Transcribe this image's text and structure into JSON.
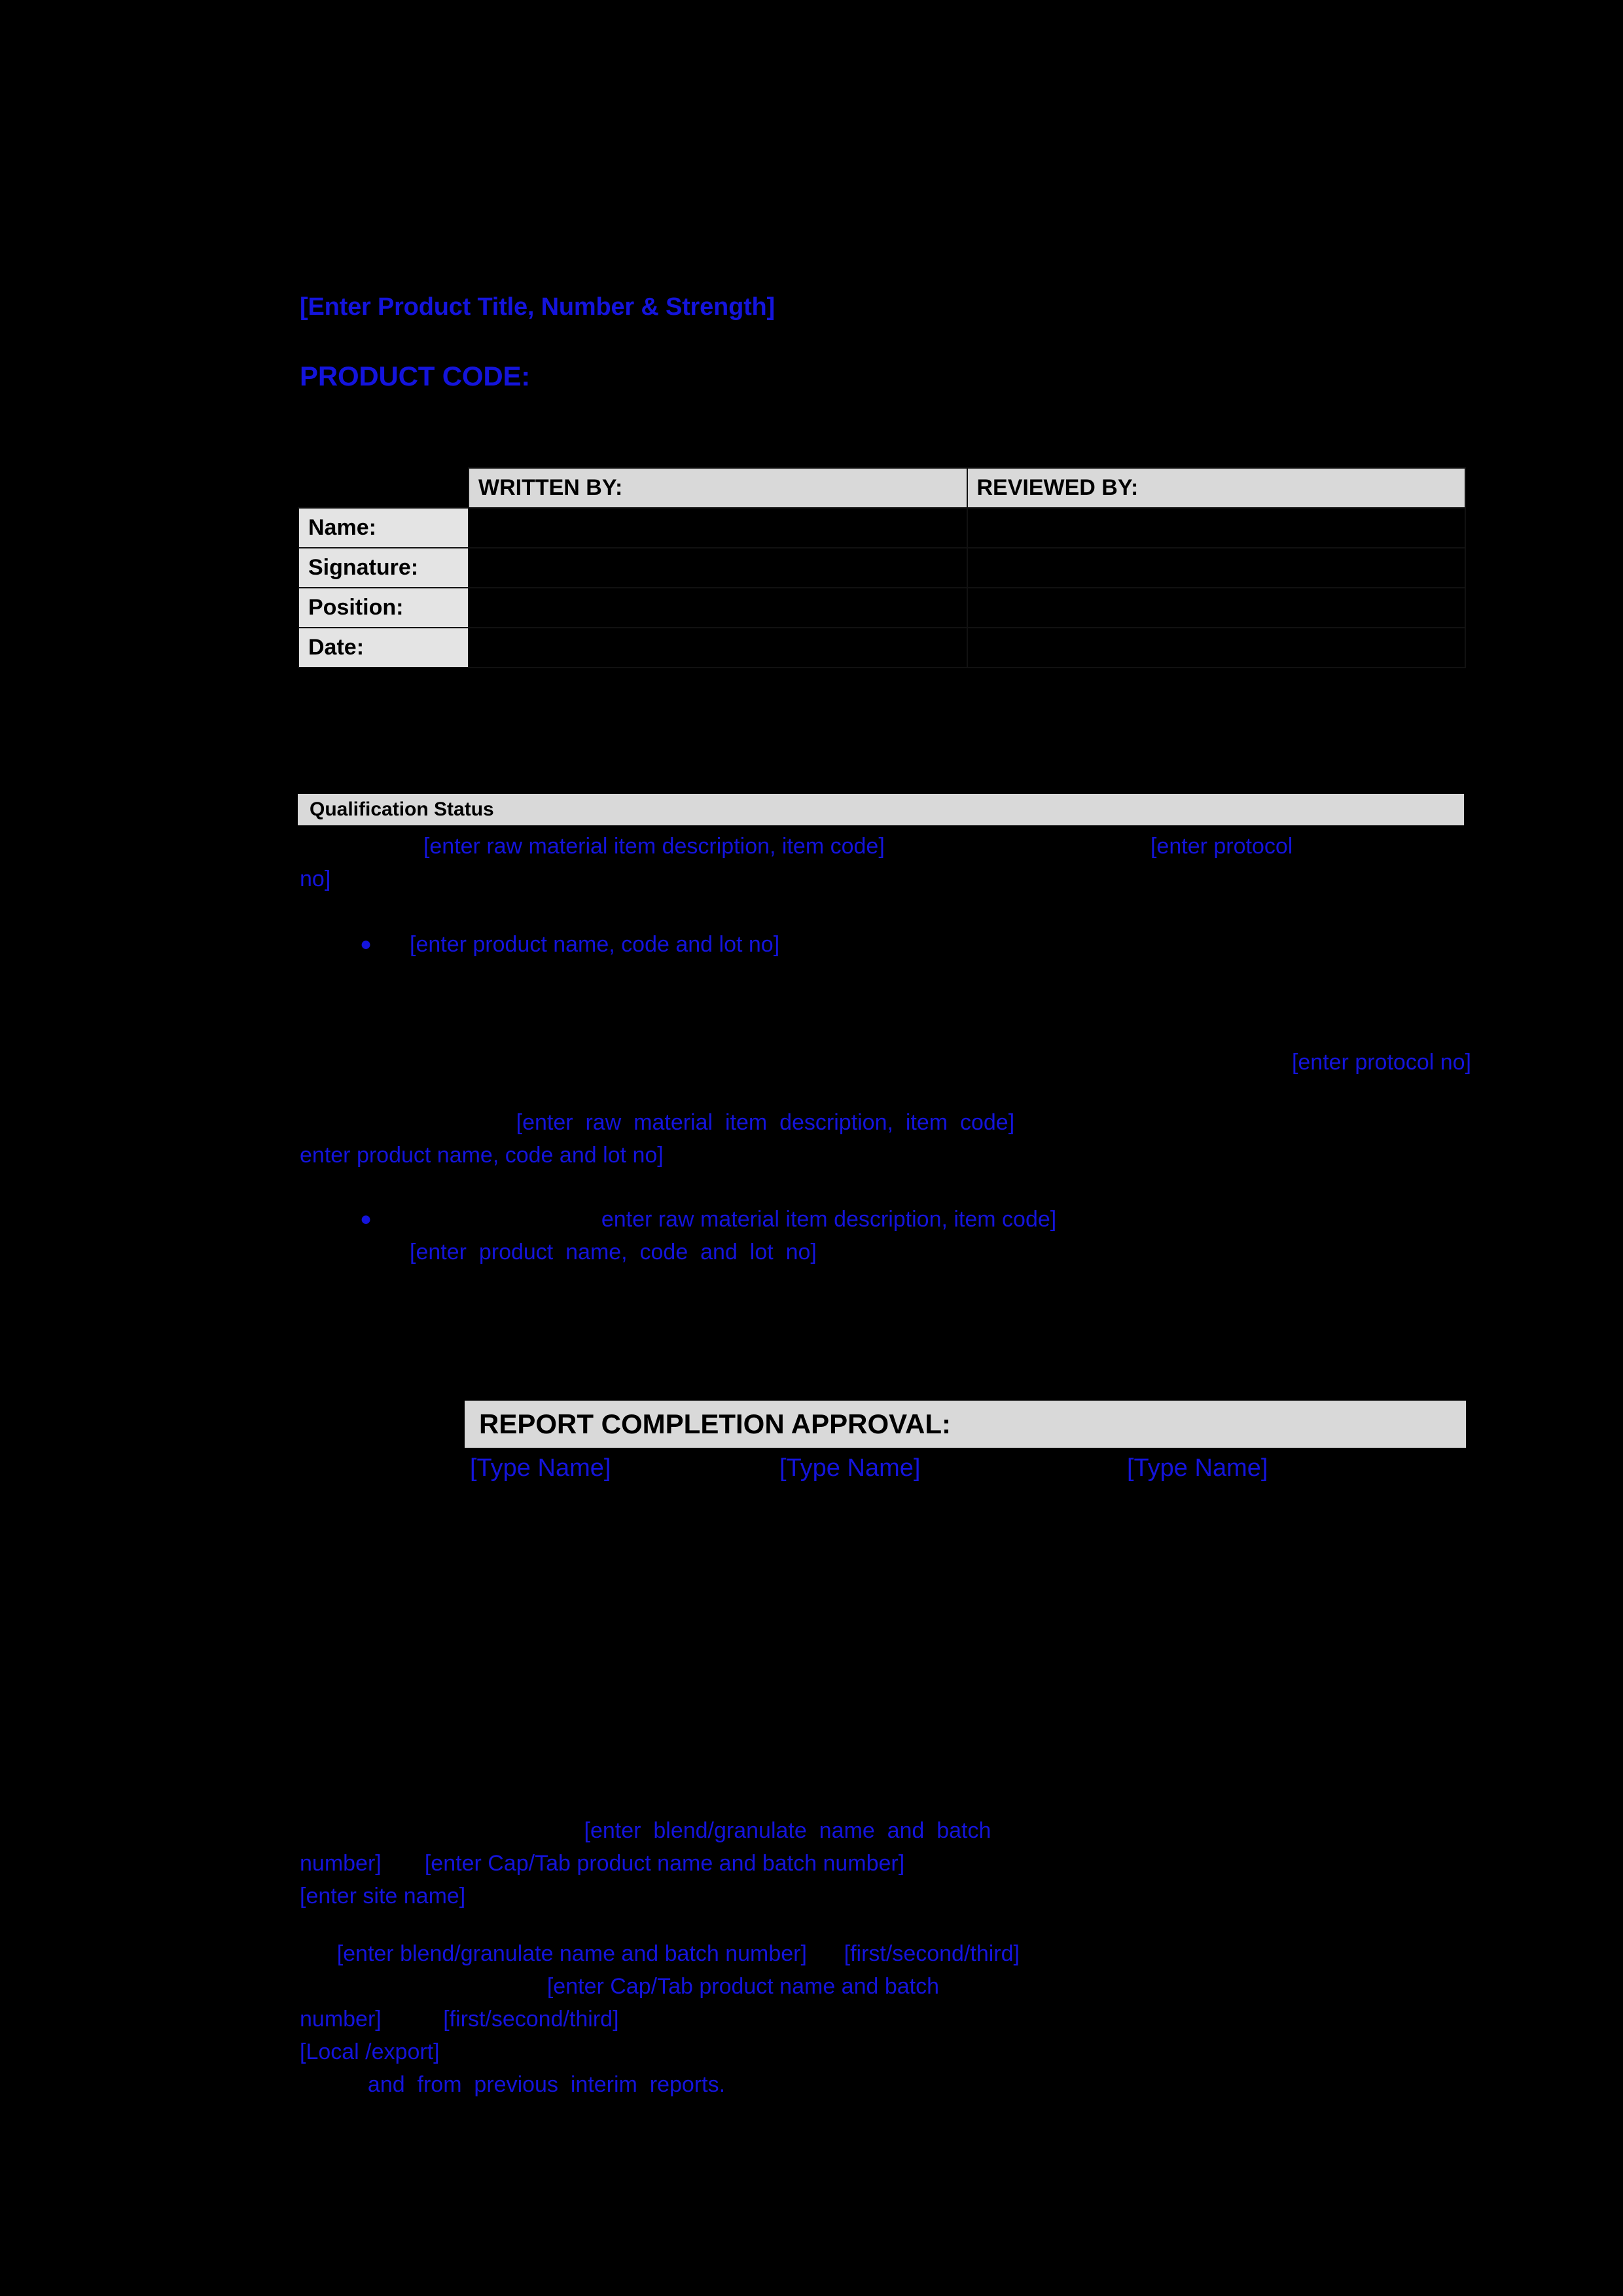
{
  "document": {
    "title": "[Enter Product Title, Number & Strength]",
    "product_code_label": "PRODUCT CODE:"
  },
  "colors": {
    "placeholder_blue": "#1414DC",
    "band_gray": "#D9D9D9",
    "label_gray": "#E4E4E4",
    "page_background": "#000000",
    "border": "#111111"
  },
  "signature_table": {
    "corner": "",
    "columns": [
      "WRITTEN BY:",
      "REVIEWED BY:"
    ],
    "rows": [
      {
        "label": "Name:",
        "written_by": "",
        "reviewed_by": ""
      },
      {
        "label": "Signature:",
        "written_by": "",
        "reviewed_by": ""
      },
      {
        "label": "Position:",
        "written_by": "",
        "reviewed_by": ""
      },
      {
        "label": "Date:",
        "written_by": "",
        "reviewed_by": ""
      }
    ]
  },
  "qualification": {
    "heading": "Qualification Status",
    "paragraph_1_lead": "                    ",
    "paragraph_1_placeholder": "[enter raw material item description, item code]",
    "paragraph_1_gap": "                                           ",
    "paragraph_1_tail": "[enter protocol",
    "paragraph_1_wrap": "no]",
    "bullet_1": "[enter product name, code and lot no]",
    "protocol_line": "[enter protocol no]",
    "paragraph_2_lead": "                                   ",
    "paragraph_2_placeholder": "[enter  raw  material  item  description,  item  code]",
    "paragraph_2_second_line": "enter product name, code and lot no]",
    "bullet_2_lead": "                               ",
    "bullet_2_placeholder": "enter raw material item description, item code]",
    "bullet_2_second_line": "[enter  product  name,  code  and  lot  no]"
  },
  "approval": {
    "heading": "REPORT COMPLETION APPROVAL:",
    "names": [
      "[Type Name]",
      "[Type Name]",
      "[Type Name]"
    ]
  },
  "closing": {
    "line_1_lead": "                                              ",
    "line_1_placeholder": "[enter  blend/granulate  name  and  batch",
    "line_2_a": "number]",
    "line_2_b": "[enter Cap/Tab product name and batch number]",
    "line_3": "[enter site name]",
    "line_4_lead": "      ",
    "line_4_a": "[enter blend/granulate name and batch number]",
    "line_4_b": "[first/second/third]",
    "line_5_lead": "                                        ",
    "line_5_a": "[enter Cap/Tab product name and batch",
    "line_6_a": "number]",
    "line_6_b": "[first/second/third]",
    "line_7": "[Local /export]",
    "line_8_lead": "           ",
    "line_8": "and  from  previous  interim  reports."
  }
}
